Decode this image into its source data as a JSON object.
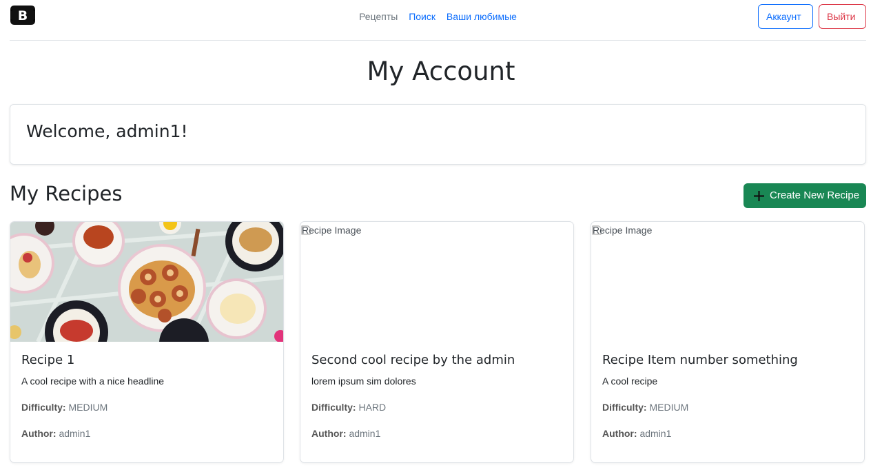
{
  "nav": {
    "items": [
      {
        "label": "Рецепты",
        "style": "muted"
      },
      {
        "label": "Поиск",
        "style": "link"
      },
      {
        "label": "Ваши любимые",
        "style": "link"
      }
    ],
    "account_label": "Аккаунт",
    "logout_label": "Выйти",
    "brand_icon": "bootstrap-logo-icon"
  },
  "page": {
    "title": "My Account",
    "welcome": "Welcome, admin1!",
    "section_title": "My Recipes",
    "create_label": "Create New Recipe"
  },
  "labels": {
    "difficulty": "Difficulty:",
    "author": "Author:"
  },
  "recipes": [
    {
      "title": "Recipe 1",
      "description": "A cool recipe with a nice headline",
      "difficulty": "MEDIUM",
      "author": "admin1",
      "image_alt": "",
      "image": "food-photo"
    },
    {
      "title": "Second cool recipe by the admin",
      "description": "lorem ipsum sim dolores",
      "difficulty": "HARD",
      "author": "admin1",
      "image_alt": "Recipe Image",
      "image": "broken"
    },
    {
      "title": "Recipe Item number something",
      "description": "A cool recipe",
      "difficulty": "MEDIUM",
      "author": "admin1",
      "image_alt": "Recipe Image",
      "image": "broken"
    }
  ],
  "colors": {
    "primary": "#0d6efd",
    "danger": "#dc3545",
    "success": "#198754",
    "muted": "#6c757d"
  }
}
